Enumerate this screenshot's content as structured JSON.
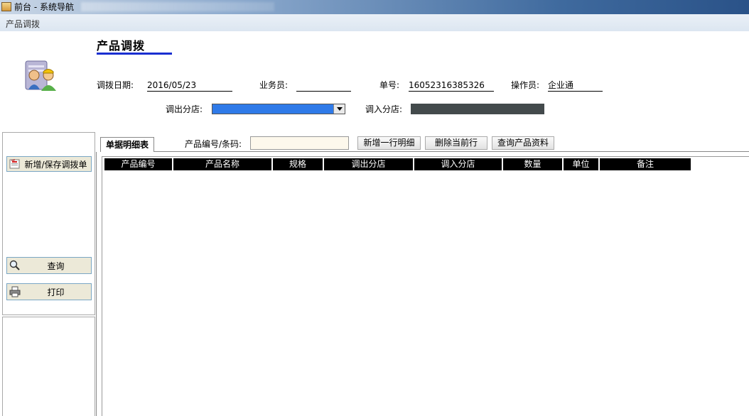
{
  "window": {
    "title": "前台 - 系统导航"
  },
  "nav": {
    "breadcrumb": "产品调拨"
  },
  "page": {
    "title": "产品调拨"
  },
  "form": {
    "date_label": "调拨日期:",
    "date_value": "2016/05/23",
    "salesperson_label": "业务员:",
    "salesperson_value": "",
    "order_no_label": "单号:",
    "order_no_value": "16052316385326",
    "operator_label": "操作员:",
    "operator_value": "企业通",
    "from_store_label": "调出分店:",
    "from_store_value": "",
    "to_store_label": "调入分店:",
    "to_store_value": ""
  },
  "sidebar": {
    "new_save_label": "新增/保存调拨单",
    "query_label": "查询",
    "print_label": "打印"
  },
  "detail": {
    "tab_label": "单据明细表",
    "code_label": "产品编号/条码:",
    "code_value": "",
    "add_row_label": "新增一行明细",
    "delete_row_label": "删除当前行",
    "query_product_label": "查询产品资料"
  },
  "table": {
    "columns": [
      "产品编号",
      "产品名称",
      "规格",
      "调出分店",
      "调入分店",
      "数量",
      "单位",
      "备注"
    ],
    "rows": []
  },
  "colors": {
    "title_underline": "#1a2fd0",
    "select_fill": "#2f7ae8",
    "dark_field": "#434a4c",
    "input_bg": "#fdf8ec",
    "header_bg": "#000000"
  }
}
